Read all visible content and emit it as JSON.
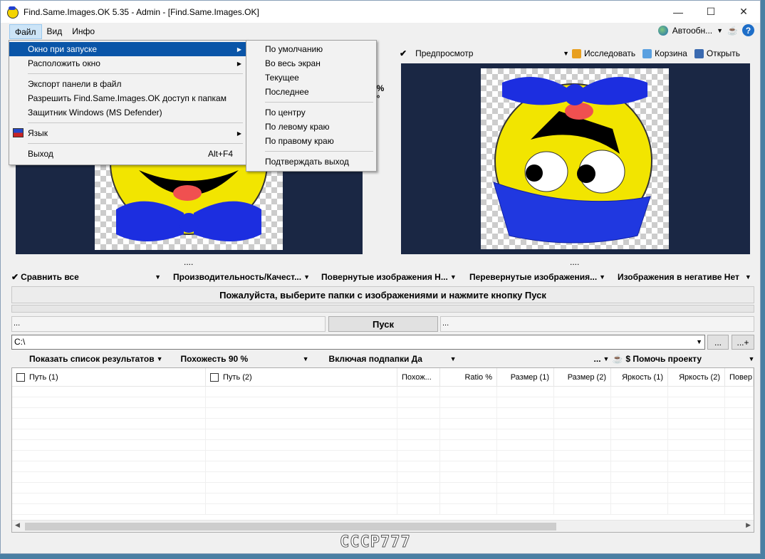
{
  "window": {
    "title": "Find.Same.Images.OK 5.35 - Admin - [Find.Same.Images.OK]",
    "minimize": "—",
    "maximize": "☐",
    "close": "✕"
  },
  "menubar": {
    "items": [
      "Файл",
      "Вид",
      "Инфо"
    ],
    "autoupdate": "Автообн...",
    "help": "?"
  },
  "file_menu": {
    "items": [
      {
        "label": "Окно при запуске",
        "submenu": true
      },
      {
        "label": "Расположить окно",
        "submenu": true
      },
      {
        "label": "Экспорт панели в файл"
      },
      {
        "label": "Разрешить Find.Same.Images.OK доступ к папкам"
      },
      {
        "label": "Защитник Windows (MS Defender)"
      },
      {
        "label": "Язык",
        "submenu": true
      },
      {
        "label": "Выход",
        "accel": "Alt+F4"
      }
    ]
  },
  "startup_submenu": {
    "items": [
      "По умолчанию",
      "Во весь экран",
      "Текущее",
      "Последнее",
      "По центру",
      "По левому краю",
      "По правому краю",
      "Подтверждать выход"
    ]
  },
  "preview_bar": {
    "check": "✔",
    "preview": "Предпросмотр",
    "explore": "Исследовать",
    "recycle": "Корзина",
    "open": "Открыть"
  },
  "mid_info": {
    "line1": "00 %",
    "line2": "80 °"
  },
  "dots": {
    "left": "....",
    "right": "...."
  },
  "options": {
    "compare_all": "Сравнить все",
    "performance": "Производительность/Качест...",
    "rotated": "Повернутые изображения Н...",
    "flipped": "Перевернутые изображения...",
    "negative": "Изображения в негативе Нет"
  },
  "message": "Пожалуйста, выберите папки с изображениями и нажмите кнопку Пуск",
  "start_row": {
    "left": "...",
    "start": "Пуск",
    "right": "..."
  },
  "path": {
    "value": "C:\\",
    "browse": "...",
    "add": "...+"
  },
  "options2": {
    "show_results": "Показать список результатов",
    "similarity": "Похожесть 90 %",
    "subfolders": "Включая подпапки Да",
    "more": "...",
    "donate": "$ Помочь проекту"
  },
  "grid": {
    "columns": [
      "Путь (1)",
      "Путь (2)",
      "Похож...",
      "Ratio %",
      "Размер (1)",
      "Размер (2)",
      "Яркость (1)",
      "Яркость (2)",
      "Повер"
    ]
  },
  "brand": "CCCP777"
}
